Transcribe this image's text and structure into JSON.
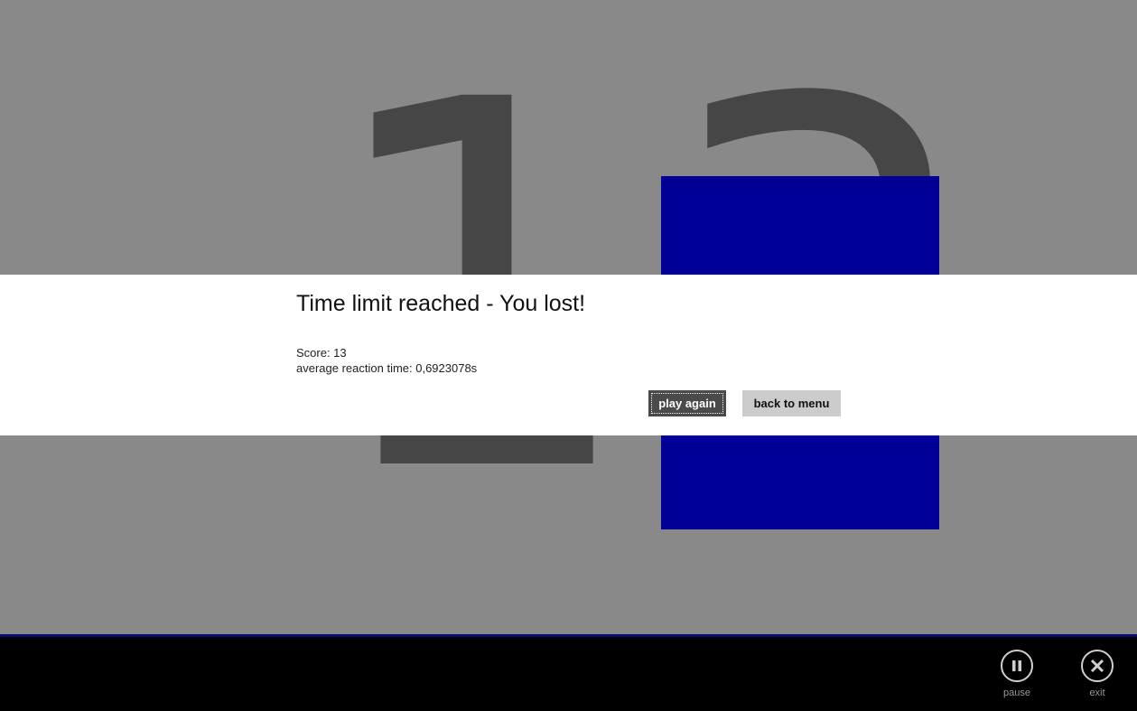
{
  "game": {
    "big_number": "13",
    "target_color": "#000096",
    "background_color": "#898989"
  },
  "dialog": {
    "title": "Time limit reached - You lost!",
    "score_line": "Score: 13",
    "reaction_line": "average reaction time: 0,6923078s",
    "play_again_label": "play again",
    "back_to_menu_label": "back to menu"
  },
  "appbar": {
    "pause": {
      "label": "pause",
      "icon": "pause-icon"
    },
    "exit": {
      "label": "exit",
      "icon": "close-icon"
    }
  }
}
